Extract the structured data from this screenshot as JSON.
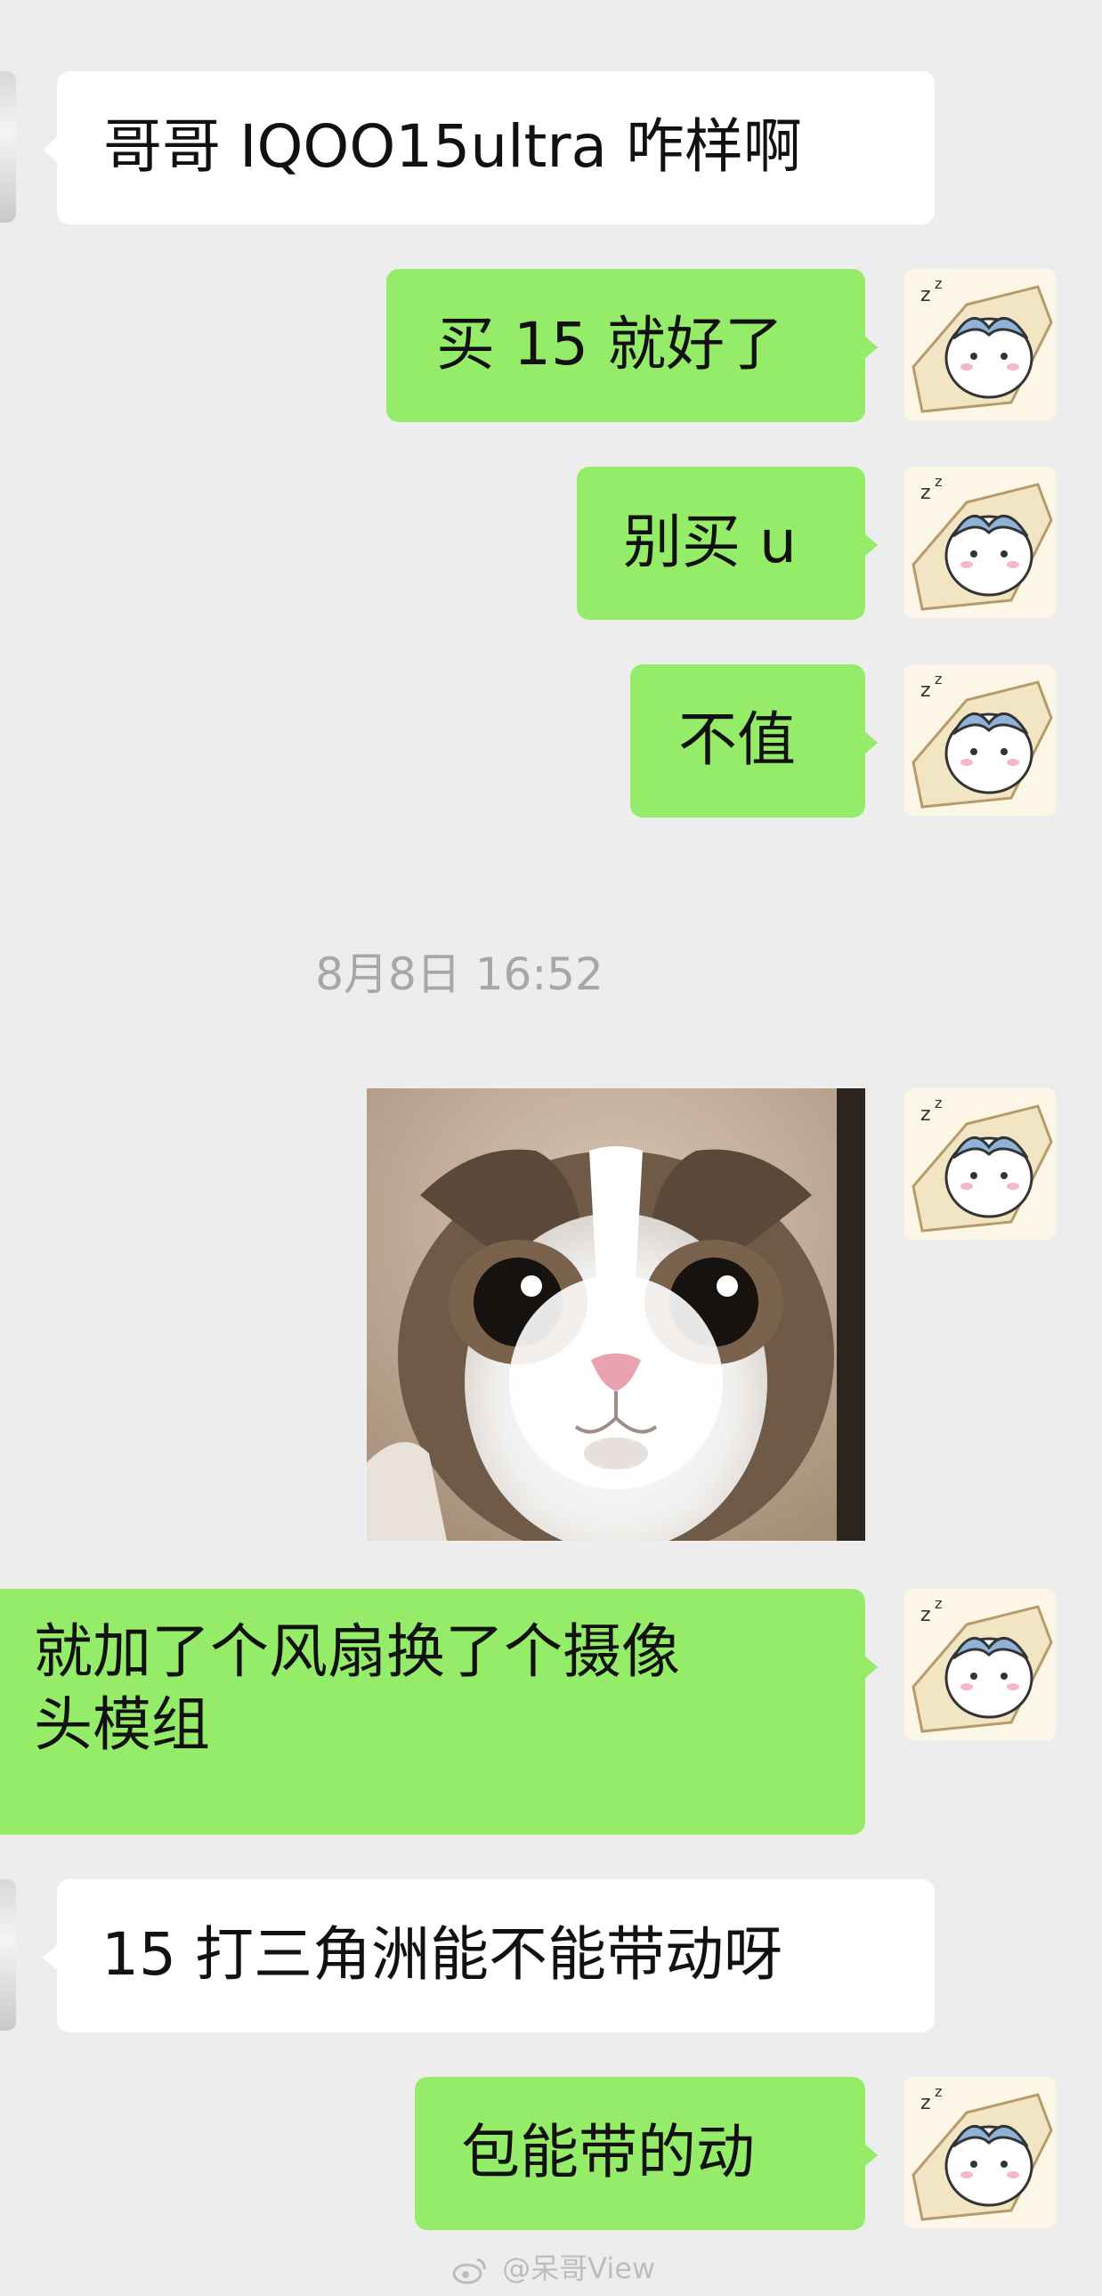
{
  "messages": [
    {
      "side": "in",
      "text": "哥哥 IQOO15ultra 咋样啊"
    },
    {
      "side": "out",
      "text": "买 15 就好了"
    },
    {
      "side": "out",
      "text": "别买 u"
    },
    {
      "side": "out",
      "text": "不值"
    },
    {
      "side": "out",
      "text": "就加了个风扇换了个摄像",
      "text2": "头模组"
    },
    {
      "side": "in",
      "text": "15 打三角洲能不能带动呀"
    },
    {
      "side": "out",
      "text": "包能带的动"
    }
  ],
  "timestamp": "8月8日 16:52",
  "image_message": {
    "description": "cat-photo"
  },
  "watermark": "@呆哥View",
  "colors": {
    "background": "#ededed",
    "outgoing_bubble": "#95ec69",
    "incoming_bubble": "#ffffff",
    "timestamp": "#a7a7a7"
  }
}
